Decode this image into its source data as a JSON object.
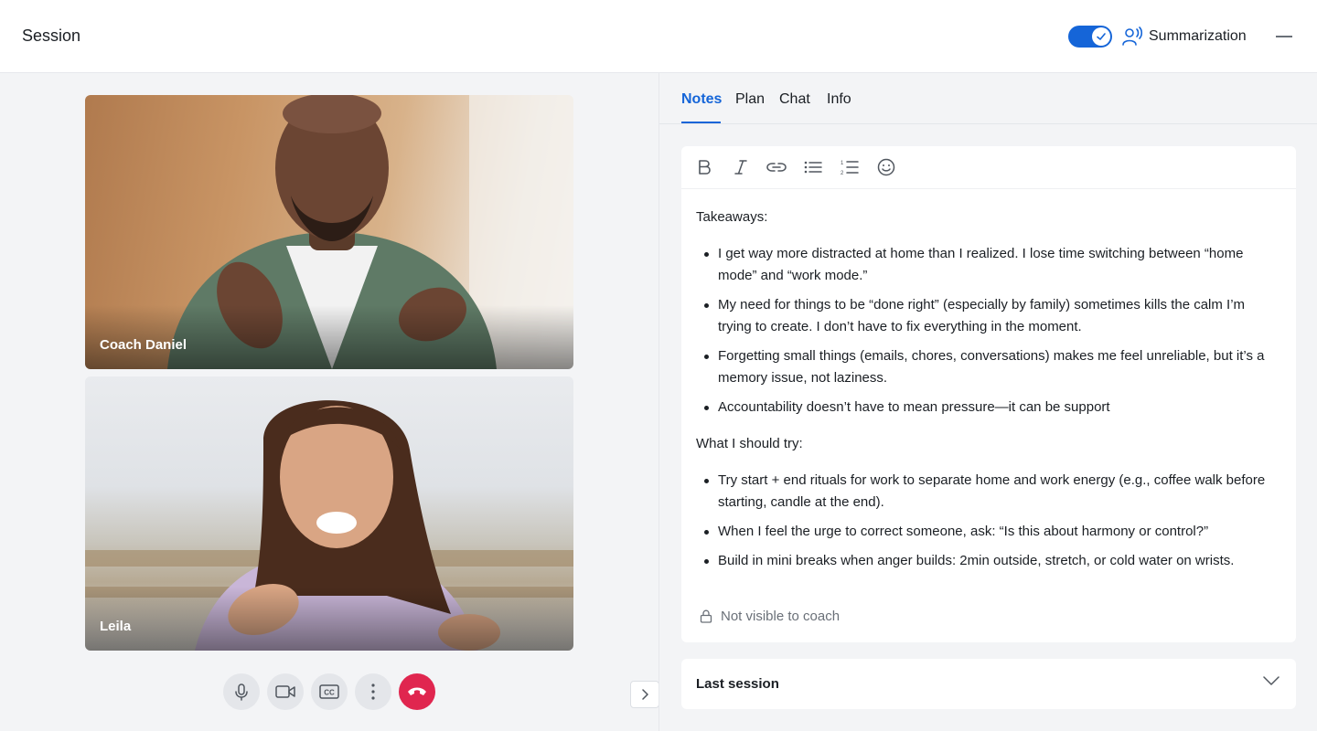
{
  "header": {
    "title": "Session",
    "summarization_label": "Summarization",
    "summarization_enabled": true
  },
  "video": {
    "tiles": [
      {
        "name": "Coach Daniel"
      },
      {
        "name": "Leila"
      }
    ],
    "controls": [
      "microphone-icon",
      "camera-icon",
      "captions-icon",
      "more-icon",
      "end-call-icon"
    ]
  },
  "panel": {
    "tabs": [
      {
        "label": "Notes",
        "active": true
      },
      {
        "label": "Plan",
        "active": false
      },
      {
        "label": "Chat",
        "active": false
      },
      {
        "label": "Info",
        "active": false
      }
    ],
    "toolbar": [
      "bold-icon",
      "italic-icon",
      "link-icon",
      "bullet-list-icon",
      "numbered-list-icon",
      "emoji-icon"
    ],
    "notes": {
      "takeaways_title": "Takeaways:",
      "takeaways": [
        "I get way more distracted at home than I realized. I lose time switching between “home mode” and “work mode.”",
        "My need for things to be “done right” (especially by family) sometimes kills the calm I’m trying to create. I don’t have to fix everything in the moment.",
        "Forgetting small things (emails, chores, conversations) makes me feel unreliable, but it’s a memory issue, not laziness.",
        "Accountability doesn’t have to mean pressure—it can be support"
      ],
      "try_title": "What I should try:",
      "try_items": [
        "Try start + end rituals for work to separate home and work energy (e.g., coffee walk before starting, candle at the end).",
        "When I feel the urge to correct someone, ask: “Is this about harmony or control?”",
        "Build in mini breaks when anger builds: 2min outside, stretch, or cold water on wrists."
      ],
      "privacy_note": "Not visible to coach"
    },
    "last_session_label": "Last session"
  },
  "colors": {
    "accent": "#1565d8",
    "end_call": "#e0264f",
    "panel_bg": "#f3f4f6"
  }
}
